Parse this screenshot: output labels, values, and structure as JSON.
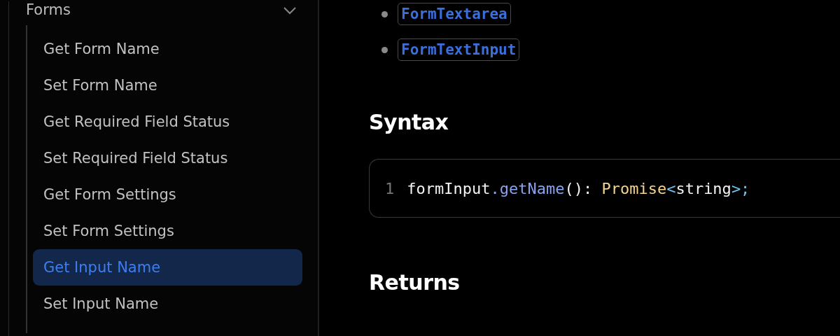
{
  "sidebar": {
    "group": {
      "label": "Forms",
      "expanded": true,
      "items": [
        {
          "label": "Get Form Name",
          "selected": false
        },
        {
          "label": "Set Form Name",
          "selected": false
        },
        {
          "label": "Get Required Field Status",
          "selected": false
        },
        {
          "label": "Set Required Field Status",
          "selected": false
        },
        {
          "label": "Get Form Settings",
          "selected": false
        },
        {
          "label": "Set Form Settings",
          "selected": false
        },
        {
          "label": "Get Input Name",
          "selected": true
        },
        {
          "label": "Set Input Name",
          "selected": false
        }
      ]
    }
  },
  "content": {
    "list_items": [
      "FormTextarea",
      "FormTextInput"
    ],
    "syntax_heading": "Syntax",
    "code": {
      "line_number": "1",
      "tokens": [
        {
          "text": "formInput",
          "kind": "plain"
        },
        {
          "text": ".getName",
          "kind": "method"
        },
        {
          "text": "(): ",
          "kind": "plain"
        },
        {
          "text": "Promise",
          "kind": "type"
        },
        {
          "text": "<",
          "kind": "punct"
        },
        {
          "text": "string",
          "kind": "plain"
        },
        {
          "text": ">;",
          "kind": "punct"
        }
      ]
    },
    "returns_heading": "Returns"
  }
}
